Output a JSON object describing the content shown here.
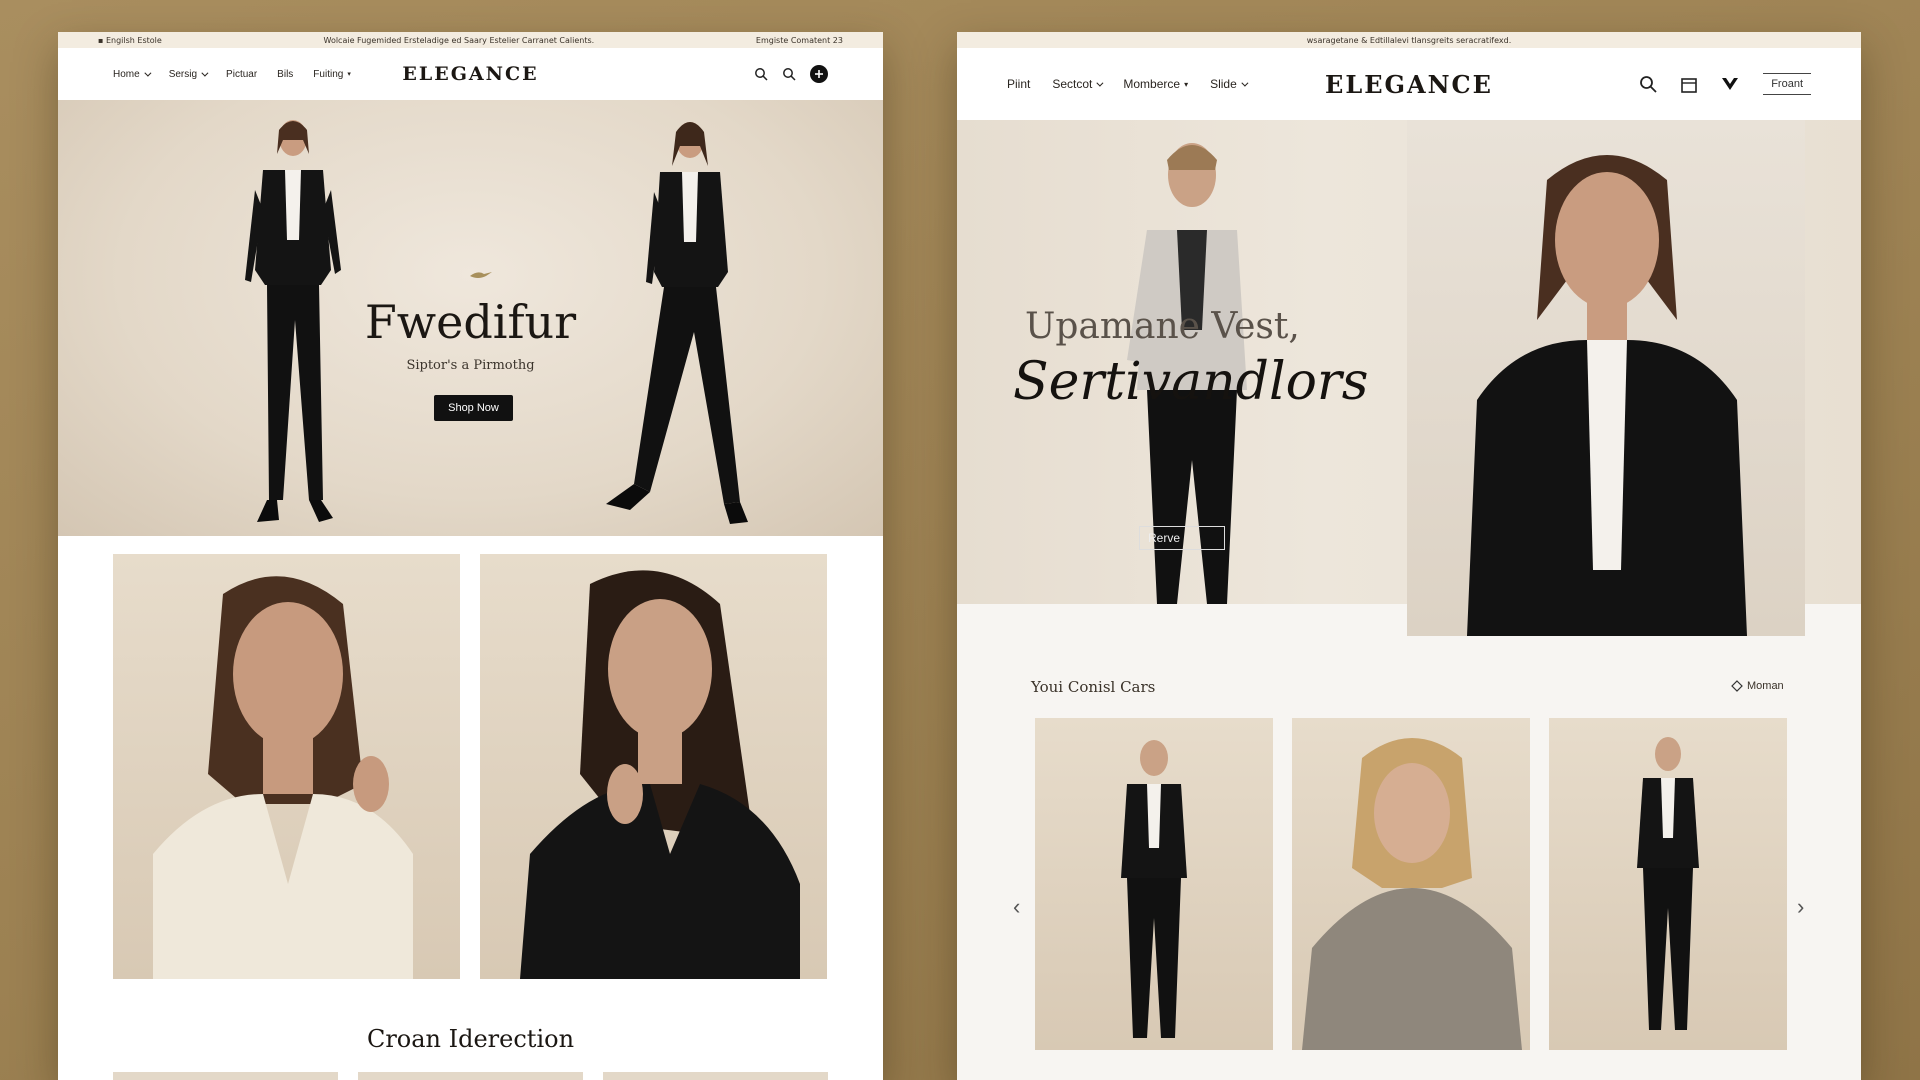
{
  "left_site": {
    "announcement": {
      "left": "▪ Engilsh Estole",
      "center": "Wolcaie Fugemided Ersteladige ed Saary Estelier Carranet Calients.",
      "right": "Emgiste Comatent 23"
    },
    "nav": {
      "items": [
        "Home",
        "Sersig",
        "Pictuar",
        "Bils",
        "Fuiting"
      ],
      "logo": "ELEGANCE"
    },
    "hero": {
      "title": "Fwedifur",
      "subtitle": "Siptor's a Pirmothg",
      "cta": "Shop Now"
    },
    "section_title": "Croan Iderection"
  },
  "right_site": {
    "announcement": "wsaragetane & Edtillalevi tlansgreits seracratifexd.",
    "nav": {
      "items": [
        "Piint",
        "Sectcot",
        "Momberce",
        "Slide"
      ],
      "logo": "ELEGANCE",
      "front_button": "Froant"
    },
    "hero": {
      "title_line1": "Upamane Vest,",
      "title_line2": "Sertivandlors",
      "cta": "Rerve"
    },
    "carousel": {
      "title": "Youi Conisl Cars",
      "more_label": "Moman"
    }
  },
  "colors": {
    "background": "#a08555",
    "accent_dark": "#111111",
    "beige": "#e3d8c8"
  }
}
